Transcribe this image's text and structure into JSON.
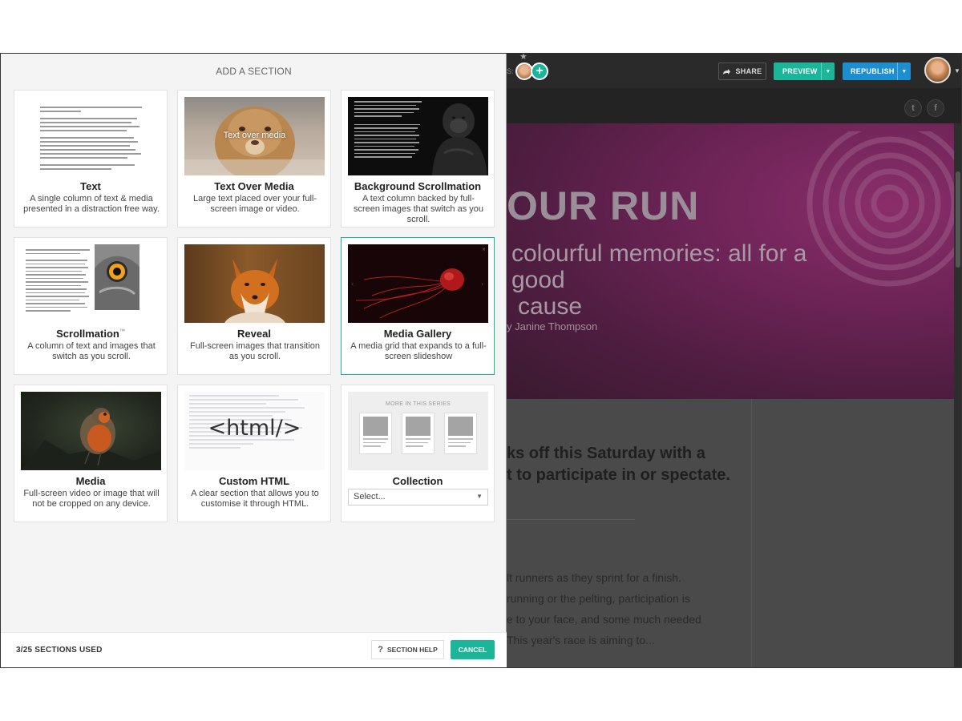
{
  "editor": {
    "share_label": "SHARE",
    "preview_label": "PREVIEW",
    "republish_label": "REPUBLISH",
    "collab_label": "S:",
    "hero_title": "OUR RUN",
    "hero_subtitle_line1": "colourful memories: all for a good",
    "hero_subtitle_line2": "cause",
    "hero_byline": "y Janine Thompson",
    "body_heading_line1": "ks off this Saturday with a",
    "body_heading_line2": "t to participate in or spectate.",
    "body_lines": [
      "lt runners as they sprint for a finish.",
      "running or the pelting, participation is",
      "e to your face, and some much needed",
      "This year's race is aiming to..."
    ],
    "twitter_icon_char": "t",
    "facebook_icon_char": "f"
  },
  "panel": {
    "title": "ADD A SECTION",
    "sections_used": "3/25 SECTIONS USED",
    "section_help_label": "SECTION HELP",
    "cancel_label": "CANCEL",
    "cards": {
      "text": {
        "title": "Text",
        "desc": "A single column of text & media presented in a distraction free way."
      },
      "text_over_media": {
        "title": "Text Over Media",
        "desc": "Large text placed over your full-screen image or video.",
        "overlay": "Text over media"
      },
      "background_scrollmation": {
        "title": "Background Scrollmation",
        "desc": "A text column backed by full-screen images that switch as you scroll."
      },
      "scrollmation": {
        "title": "Scrollmation",
        "tm": "™",
        "desc": "A column of text and images that switch as you scroll."
      },
      "reveal": {
        "title": "Reveal",
        "desc": "Full-screen images that transition as you scroll."
      },
      "media_gallery": {
        "title": "Media Gallery",
        "desc": "A media grid that expands to a full-screen slideshow"
      },
      "media": {
        "title": "Media",
        "desc": "Full-screen video or image that will not be cropped on any device."
      },
      "custom_html": {
        "title": "Custom HTML",
        "desc": "A clear section that allows you to customise it through HTML.",
        "thumb_text": "<html/>"
      },
      "collection": {
        "title": "Collection",
        "thumb_header": "MORE IN THIS SERIES",
        "select_value": "Select..."
      }
    }
  },
  "colors": {
    "accent_green": "#1bb69a",
    "accent_blue": "#1d8fd1",
    "hero_magenta": "#6e2457"
  }
}
